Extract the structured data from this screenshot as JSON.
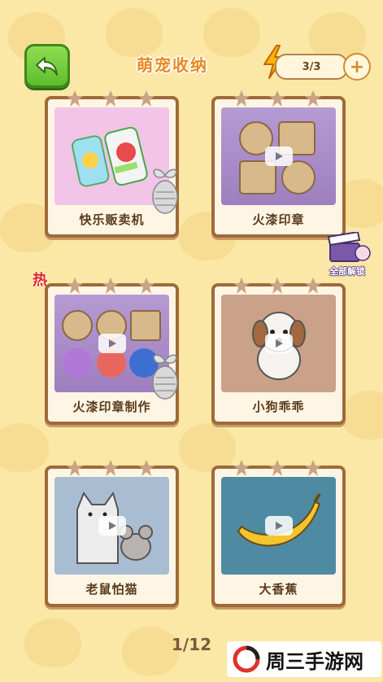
{
  "header": {
    "title": "萌宠收纳",
    "energy": "3/3",
    "plus": "+"
  },
  "hot_badge": "热",
  "unlock_all": "全部解锁",
  "cards": [
    {
      "label": "快乐贩卖机"
    },
    {
      "label": "火漆印章"
    },
    {
      "label": "火漆印章制作"
    },
    {
      "label": "小狗乖乖"
    },
    {
      "label": "老鼠怕猫"
    },
    {
      "label": "大香蕉"
    }
  ],
  "pager": "1/12",
  "watermark": "周三手游网",
  "colors": {
    "accent": "#e88a20",
    "frame": "#a0693a",
    "back": "#5fbd2c"
  }
}
